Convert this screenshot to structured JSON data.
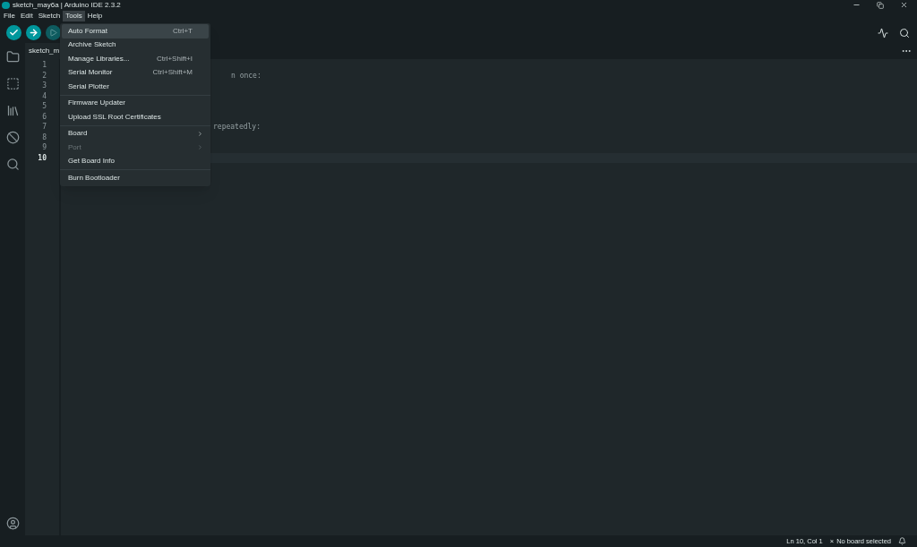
{
  "window": {
    "title": "sketch_may6a | Arduino IDE 2.3.2"
  },
  "menubar": [
    {
      "label": "File",
      "selected": false
    },
    {
      "label": "Edit",
      "selected": false
    },
    {
      "label": "Sketch",
      "selected": false
    },
    {
      "label": "Tools",
      "selected": true
    },
    {
      "label": "Help",
      "selected": false
    }
  ],
  "editor": {
    "tab": "sketch_m",
    "lines": [
      {
        "number": "1",
        "current": false
      },
      {
        "number": "2",
        "text": "n once:",
        "current": false
      },
      {
        "number": "3",
        "current": false
      },
      {
        "number": "4",
        "current": false
      },
      {
        "number": "5",
        "current": false
      },
      {
        "number": "6",
        "current": false
      },
      {
        "number": "7",
        "text": "repeatedly:",
        "current": false
      },
      {
        "number": "8",
        "current": false
      },
      {
        "number": "9",
        "current": false
      },
      {
        "number": "10",
        "current": true
      }
    ]
  },
  "tools_menu": [
    {
      "label": "Auto Format",
      "shortcut": "Ctrl+T",
      "selected": true,
      "disabled": false,
      "submenu": false,
      "separator_before": false
    },
    {
      "label": "Archive Sketch",
      "selected": false,
      "disabled": false,
      "submenu": false,
      "separator_before": false
    },
    {
      "label": "Manage Libraries...",
      "shortcut": "Ctrl+Shift+I",
      "selected": false,
      "disabled": false,
      "submenu": false,
      "separator_before": false
    },
    {
      "label": "Serial Monitor",
      "shortcut": "Ctrl+Shift+M",
      "selected": false,
      "disabled": false,
      "submenu": false,
      "separator_before": false
    },
    {
      "label": "Serial Plotter",
      "selected": false,
      "disabled": false,
      "submenu": false,
      "separator_before": false
    },
    {
      "label": "Firmware Updater",
      "selected": false,
      "disabled": false,
      "submenu": false,
      "separator_before": true
    },
    {
      "label": "Upload SSL Root Certificates",
      "selected": false,
      "disabled": false,
      "submenu": false,
      "separator_before": false
    },
    {
      "label": "Board",
      "selected": false,
      "disabled": false,
      "submenu": true,
      "separator_before": true
    },
    {
      "label": "Port",
      "selected": false,
      "disabled": true,
      "submenu": true,
      "separator_before": false
    },
    {
      "label": "Get Board Info",
      "selected": false,
      "disabled": false,
      "submenu": false,
      "separator_before": false
    },
    {
      "label": "Burn Bootloader",
      "selected": false,
      "disabled": false,
      "submenu": false,
      "separator_before": true
    }
  ],
  "status_bar": {
    "position": "Ln 10, Col 1",
    "board": "No board selected",
    "board_icon": "×"
  }
}
